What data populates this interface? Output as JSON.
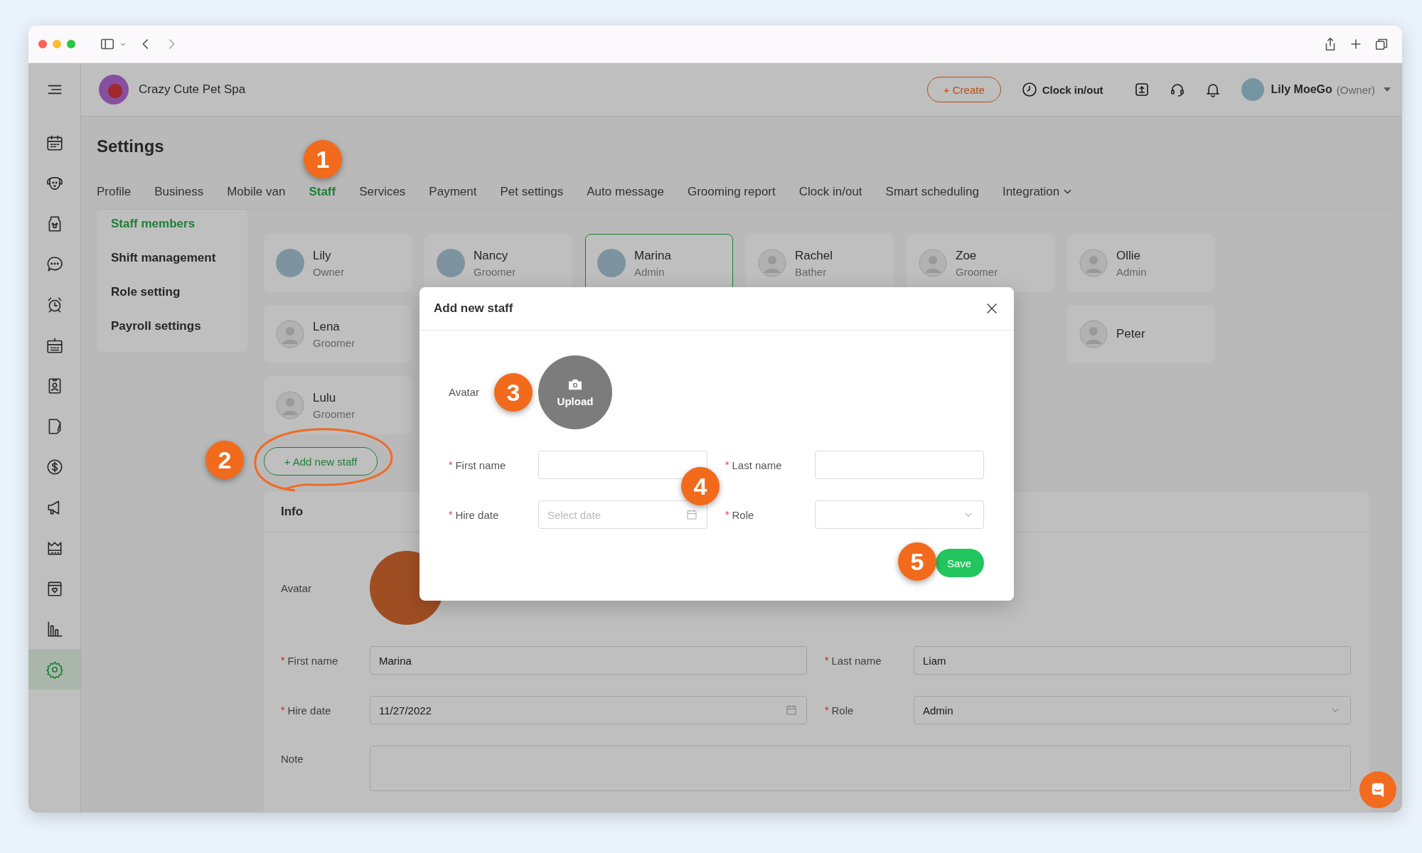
{
  "brand": {
    "name": "Crazy Cute Pet Spa"
  },
  "topbar": {
    "create": "+ Create",
    "clock": "Clock in/out",
    "user": {
      "name": "Lily MoeGo",
      "role": "(Owner)"
    }
  },
  "sidebar": {
    "items": [
      {
        "selected": false
      },
      {
        "selected": false
      },
      {
        "selected": false
      },
      {
        "selected": false
      },
      {
        "selected": false
      },
      {
        "selected": false
      },
      {
        "selected": false
      },
      {
        "selected": false
      },
      {
        "selected": false
      },
      {
        "selected": false
      },
      {
        "selected": false
      },
      {
        "selected": false
      },
      {
        "selected": false
      },
      {
        "selected": true
      }
    ]
  },
  "page": {
    "title": "Settings"
  },
  "tabs": [
    {
      "label": "Profile",
      "selected": false,
      "kind": "tab"
    },
    {
      "label": "Business",
      "selected": false,
      "kind": "tab"
    },
    {
      "label": "Mobile van",
      "selected": false,
      "kind": "tab"
    },
    {
      "label": "Staff",
      "selected": true,
      "kind": "tab"
    },
    {
      "label": "Services",
      "selected": false,
      "kind": "tab"
    },
    {
      "label": "Payment",
      "selected": false,
      "kind": "tab"
    },
    {
      "label": "Pet settings",
      "selected": false,
      "kind": "tab"
    },
    {
      "label": "Auto message",
      "selected": false,
      "kind": "tab"
    },
    {
      "label": "Grooming report",
      "selected": false,
      "kind": "tab"
    },
    {
      "label": "Clock in/out",
      "selected": false,
      "kind": "tab"
    },
    {
      "label": "Smart scheduling",
      "selected": false,
      "kind": "tab"
    },
    {
      "label": "Integration",
      "selected": false,
      "kind": "menu"
    }
  ],
  "staff_menu": [
    {
      "label": "Staff members",
      "selected": true
    },
    {
      "label": "Shift management",
      "selected": false
    },
    {
      "label": "Role setting",
      "selected": false
    },
    {
      "label": "Payroll settings",
      "selected": false
    }
  ],
  "staff_rows": [
    [
      {
        "name": "Lily",
        "role": "Owner",
        "has_photo": true,
        "selected": false
      },
      {
        "name": "Nancy",
        "role": "Groomer",
        "has_photo": true,
        "selected": false
      },
      {
        "name": "Marina",
        "role": "Admin",
        "has_photo": true,
        "selected": true
      },
      {
        "name": "Rachel",
        "role": "Bather",
        "has_photo": false,
        "selected": false
      },
      {
        "name": "Zoe",
        "role": "Groomer",
        "has_photo": false,
        "selected": false
      },
      {
        "name": "Ollie",
        "role": "Admin",
        "has_photo": false,
        "selected": false
      }
    ],
    [
      {
        "name": "Lena",
        "role": "Groomer",
        "has_photo": false,
        "selected": false
      },
      {
        "name": "Peter",
        "has_photo": false,
        "selected": false
      }
    ],
    [
      {
        "name": "Lulu",
        "role": "Groomer",
        "has_photo": false,
        "selected": false
      }
    ]
  ],
  "add_staff_button": "+ Add new staff",
  "info": {
    "title": "Info",
    "avatar_label": "Avatar",
    "fields": [
      {
        "mark": "*",
        "label": "First name",
        "value": "Marina",
        "kind": "text"
      },
      {
        "mark": "*",
        "label": "Last name",
        "value": "Liam",
        "kind": "text"
      },
      {
        "mark": "*",
        "label": "Hire date",
        "value": "11/27/2022",
        "kind": "date"
      },
      {
        "mark": "*",
        "label": "Role",
        "value": "Admin",
        "kind": "select"
      }
    ],
    "note_label": "Note"
  },
  "modal": {
    "title": "Add new staff",
    "avatar_label": "Avatar",
    "upload": "Upload",
    "fields": [
      {
        "mark": "*",
        "label": "First name",
        "kind": "text"
      },
      {
        "mark": "*",
        "label": "Last name",
        "kind": "text"
      },
      {
        "mark": "*",
        "label": "Hire date",
        "placeholder": "Select date",
        "kind": "date"
      },
      {
        "mark": "*",
        "label": "Role",
        "kind": "select"
      }
    ],
    "save": "Save"
  },
  "annotations": [
    {
      "number": "1"
    },
    {
      "number": "2"
    },
    {
      "number": "3"
    },
    {
      "number": "4"
    },
    {
      "number": "5"
    }
  ]
}
